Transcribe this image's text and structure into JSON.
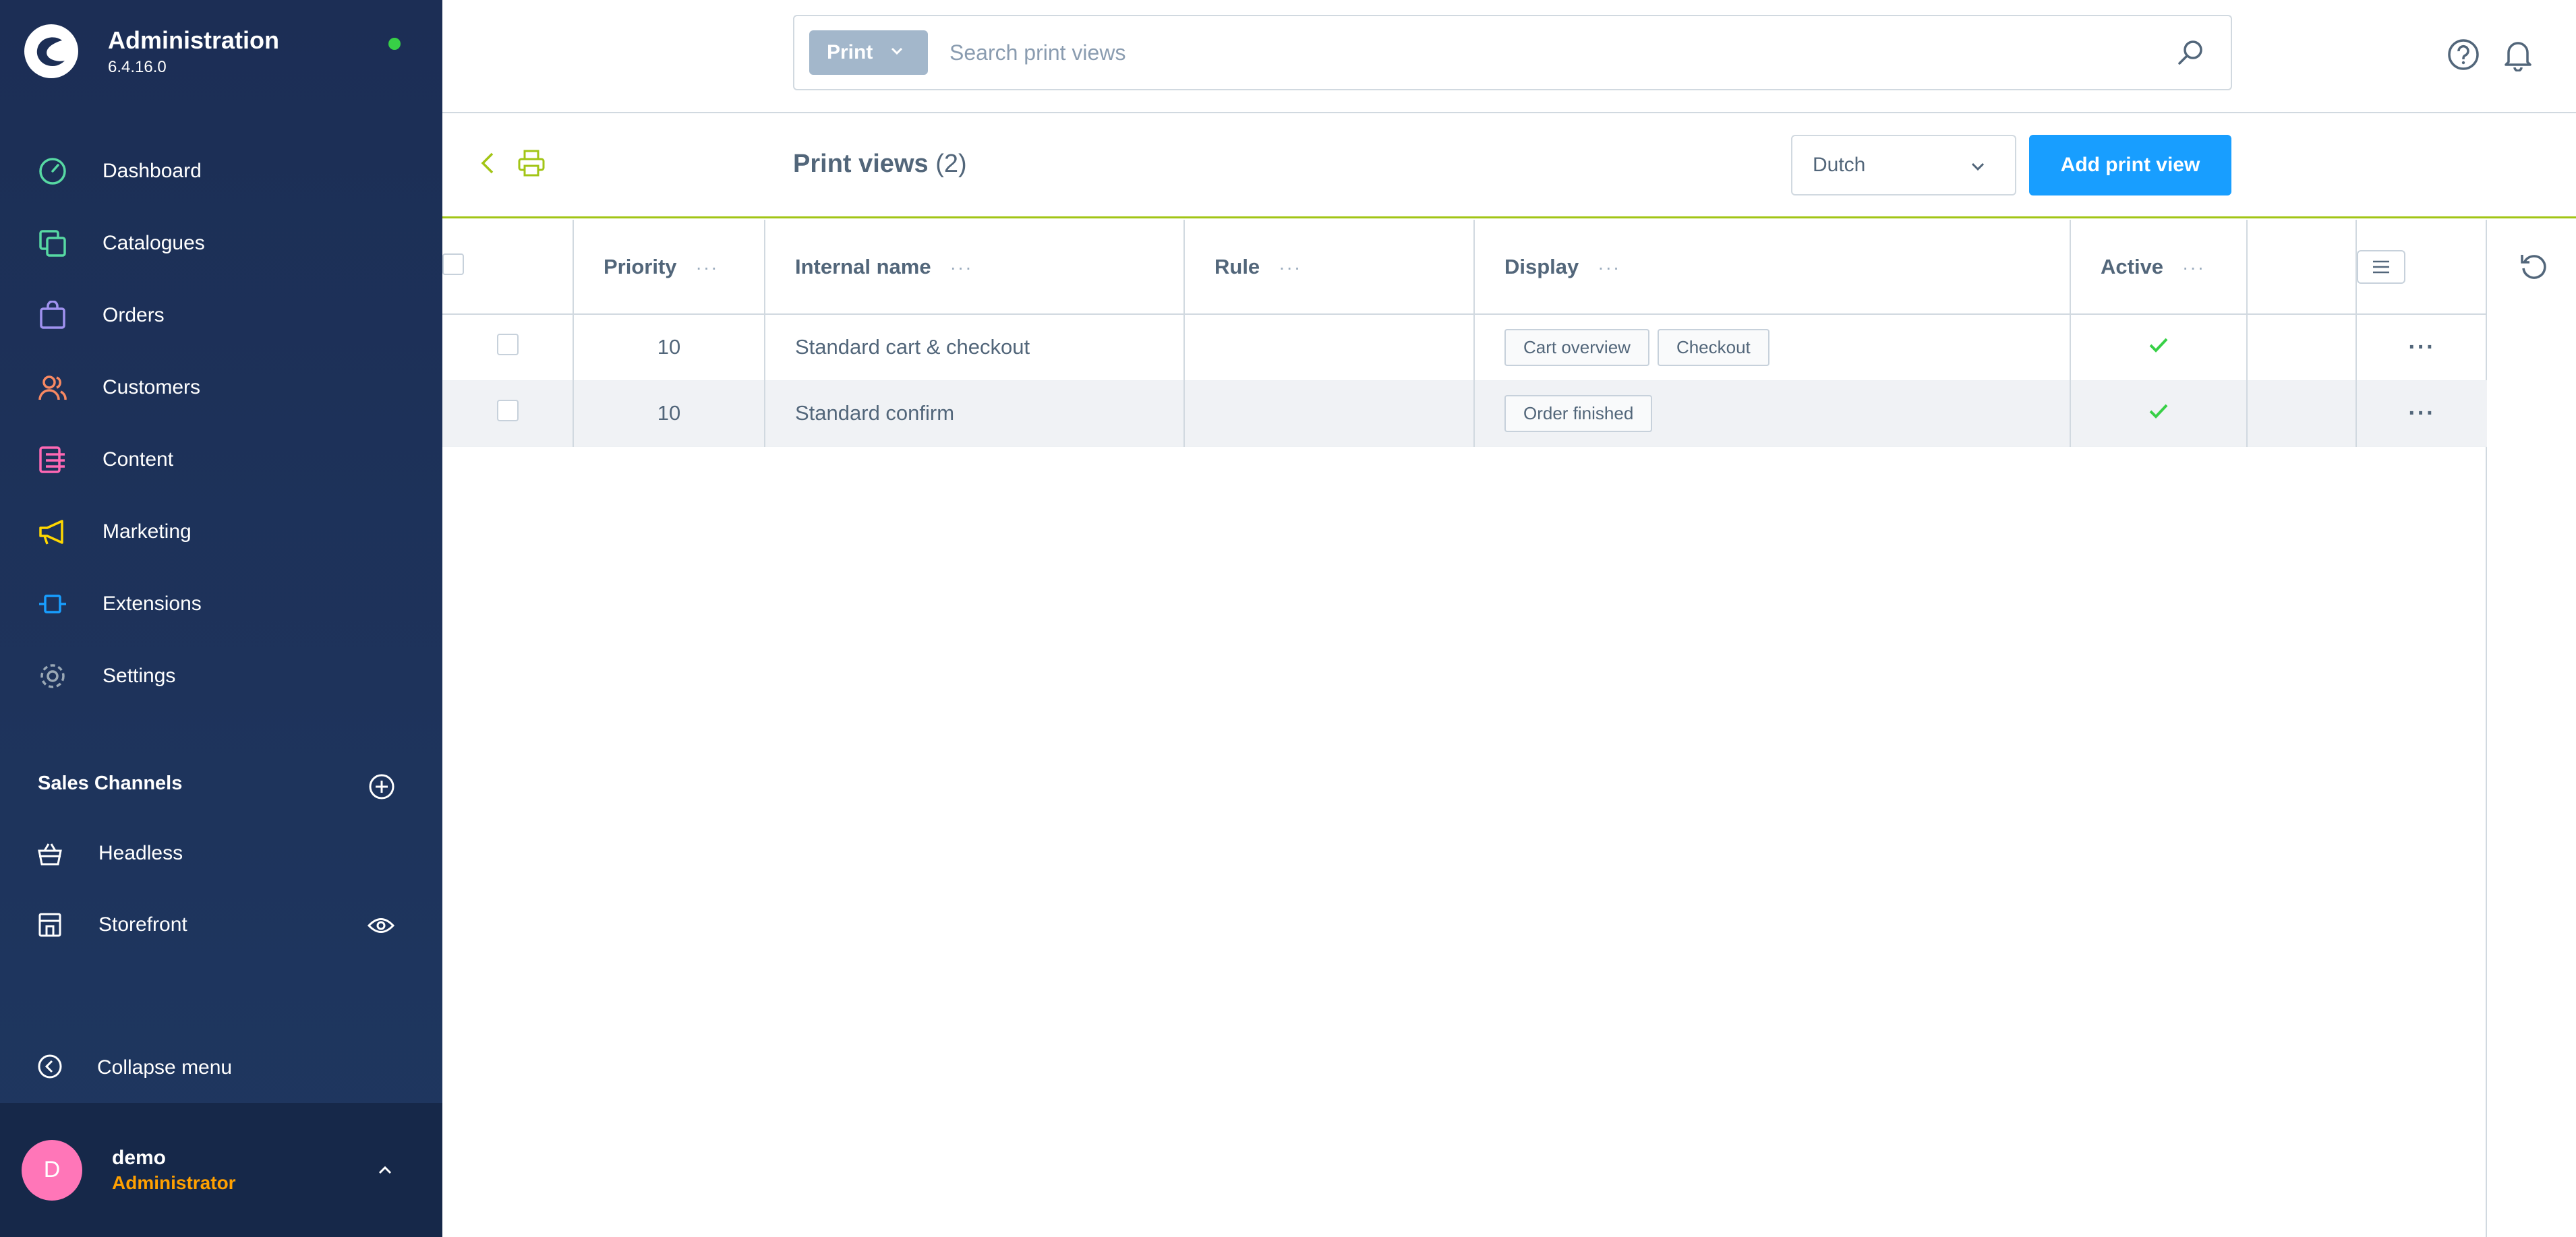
{
  "app": {
    "title": "Administration",
    "version": "6.4.16.0",
    "status_color": "#37d046"
  },
  "sidebar": {
    "items": [
      {
        "label": "Dashboard",
        "icon": "dashboard-icon",
        "color": "#57d9a3"
      },
      {
        "label": "Catalogues",
        "icon": "catalogue-icon",
        "color": "#57d9a3"
      },
      {
        "label": "Orders",
        "icon": "orders-icon",
        "color": "#a092f0"
      },
      {
        "label": "Customers",
        "icon": "customers-icon",
        "color": "#f88962"
      },
      {
        "label": "Content",
        "icon": "content-icon",
        "color": "#ff68b4"
      },
      {
        "label": "Marketing",
        "icon": "marketing-icon",
        "color": "#ffd700"
      },
      {
        "label": "Extensions",
        "icon": "extensions-icon",
        "color": "#189eff"
      },
      {
        "label": "Settings",
        "icon": "settings-icon",
        "color": "#9aa8b5"
      }
    ],
    "sales_channels_label": "Sales Channels",
    "sales_channels": [
      {
        "label": "Headless",
        "icon": "basket-icon"
      },
      {
        "label": "Storefront",
        "icon": "storefront-icon"
      }
    ],
    "collapse_label": "Collapse menu"
  },
  "user": {
    "initial": "D",
    "name": "demo",
    "role": "Administrator",
    "avatar_color": "#ff76b8",
    "role_color": "#ffa000"
  },
  "search": {
    "type_label": "Print",
    "placeholder": "Search print views"
  },
  "page": {
    "title": "Print views",
    "count": "(2)",
    "language": "Dutch",
    "add_button": "Add print view",
    "accent_color": "#189eff"
  },
  "grid": {
    "columns": [
      "Priority",
      "Internal name",
      "Rule",
      "Display",
      "Active"
    ],
    "rows": [
      {
        "priority": "10",
        "name": "Standard cart & checkout",
        "rule": "",
        "display": [
          "Cart overview",
          "Checkout"
        ],
        "active": true
      },
      {
        "priority": "10",
        "name": "Standard confirm",
        "rule": "",
        "display": [
          "Order finished"
        ],
        "active": true
      }
    ]
  }
}
